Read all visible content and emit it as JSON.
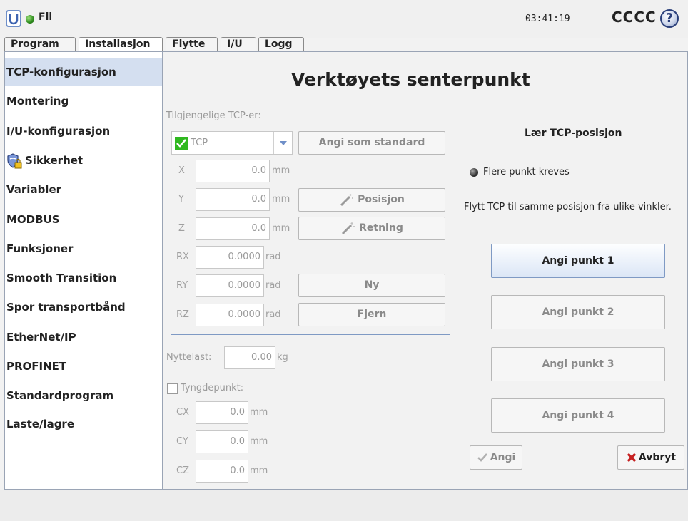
{
  "header": {
    "menu_label": "Fil",
    "clock": "03:41:19",
    "robot_name": "CCCC",
    "help_glyph": "?"
  },
  "tabs": [
    {
      "label": "Program"
    },
    {
      "label": "Installasjon"
    },
    {
      "label": "Flytte"
    },
    {
      "label": "I/U"
    },
    {
      "label": "Logg"
    }
  ],
  "sidebar": {
    "items": [
      {
        "label": "TCP-konfigurasjon"
      },
      {
        "label": "Montering"
      },
      {
        "label": "I/U-konfigurasjon"
      },
      {
        "label": "Sikkerhet"
      },
      {
        "label": "Variabler"
      },
      {
        "label": "MODBUS"
      },
      {
        "label": "Funksjoner"
      },
      {
        "label": "Smooth Transition"
      },
      {
        "label": "Spor transportbånd"
      },
      {
        "label": "EtherNet/IP"
      },
      {
        "label": "PROFINET"
      },
      {
        "label": "Standardprogram"
      },
      {
        "label": "Laste/lagre"
      }
    ]
  },
  "main": {
    "title": "Verktøyets senterpunkt",
    "available_label": "Tilgjengelige TCP-er:",
    "tcp_selected": "TCP",
    "set_default_button": "Angi som standard",
    "pose": [
      {
        "axis": "X",
        "value": "0.0",
        "unit": "mm"
      },
      {
        "axis": "Y",
        "value": "0.0",
        "unit": "mm"
      },
      {
        "axis": "Z",
        "value": "0.0",
        "unit": "mm"
      },
      {
        "axis": "RX",
        "value": "0.0000",
        "unit": "rad"
      },
      {
        "axis": "RY",
        "value": "0.0000",
        "unit": "rad"
      },
      {
        "axis": "RZ",
        "value": "0.0000",
        "unit": "rad"
      }
    ],
    "position_button": "Posisjon",
    "orientation_button": "Retning",
    "new_button": "Ny",
    "remove_button": "Fjern",
    "payload_label": "Nyttelast:",
    "payload_value": "0.00",
    "payload_unit": "kg",
    "cog_label": "Tyngdepunkt:",
    "cog": [
      {
        "axis": "CX",
        "value": "0.0",
        "unit": "mm"
      },
      {
        "axis": "CY",
        "value": "0.0",
        "unit": "mm"
      },
      {
        "axis": "CZ",
        "value": "0.0",
        "unit": "mm"
      }
    ]
  },
  "teach": {
    "title": "Lær TCP-posisjon",
    "status": "Flere punkt kreves",
    "instruction": "Flytt TCP til samme posisjon fra ulike vinkler.",
    "point_buttons": [
      "Angi punkt 1",
      "Angi punkt 2",
      "Angi punkt 3",
      "Angi punkt 4"
    ],
    "set_button": "Angi",
    "cancel_button": "Avbryt"
  },
  "colors": {
    "accent_blue": "#7f9ac4",
    "active_sidebar": "#d4dff0",
    "status_green": "#2e8b1e",
    "cancel_red": "#c62020"
  }
}
